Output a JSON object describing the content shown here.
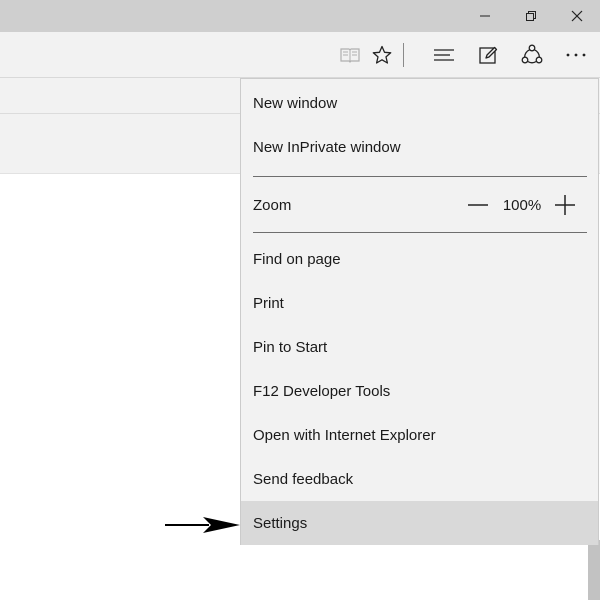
{
  "window_controls": {
    "minimize_icon": "minimize-icon",
    "restore_icon": "restore-icon",
    "close_icon": "close-icon"
  },
  "toolbar": {
    "icons": [
      "reading-view-icon",
      "favorite-star-icon",
      "hub-icon",
      "web-note-icon",
      "share-icon",
      "more-actions-icon"
    ]
  },
  "menu": {
    "new_window": "New window",
    "new_inprivate_window": "New InPrivate window",
    "zoom_label": "Zoom",
    "zoom_value": "100%",
    "find_on_page": "Find on page",
    "print": "Print",
    "pin_to_start": "Pin to Start",
    "developer_tools": "F12 Developer Tools",
    "open_with_ie": "Open with Internet Explorer",
    "send_feedback": "Send feedback",
    "settings": "Settings",
    "selected_item": "Settings"
  },
  "colors": {
    "titlebar": "#cfcfcf",
    "toolbar": "#f2f2f2",
    "menu_background": "#f2f2f2",
    "menu_highlight": "#d9d9d9",
    "text": "#1a1a1a"
  }
}
